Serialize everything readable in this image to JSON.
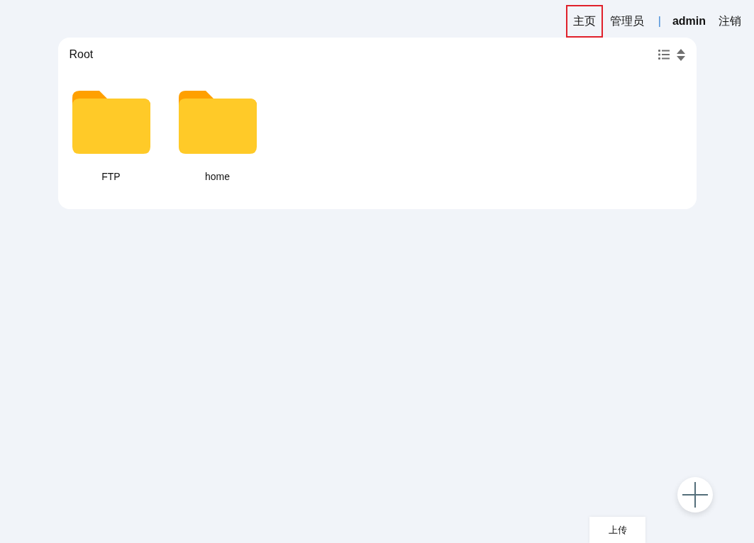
{
  "nav": [
    {
      "kind": "link",
      "label": "主页",
      "selected": true
    },
    {
      "kind": "link",
      "label": "管理员",
      "selected": false
    },
    {
      "kind": "separator",
      "label": "|"
    },
    {
      "kind": "user",
      "label": "admin"
    },
    {
      "kind": "link",
      "label": "注销",
      "selected": false
    }
  ],
  "panel": {
    "title": "Root",
    "folders": [
      {
        "name": "FTP"
      },
      {
        "name": "home"
      }
    ]
  },
  "fab": {
    "tooltip": "上传"
  }
}
